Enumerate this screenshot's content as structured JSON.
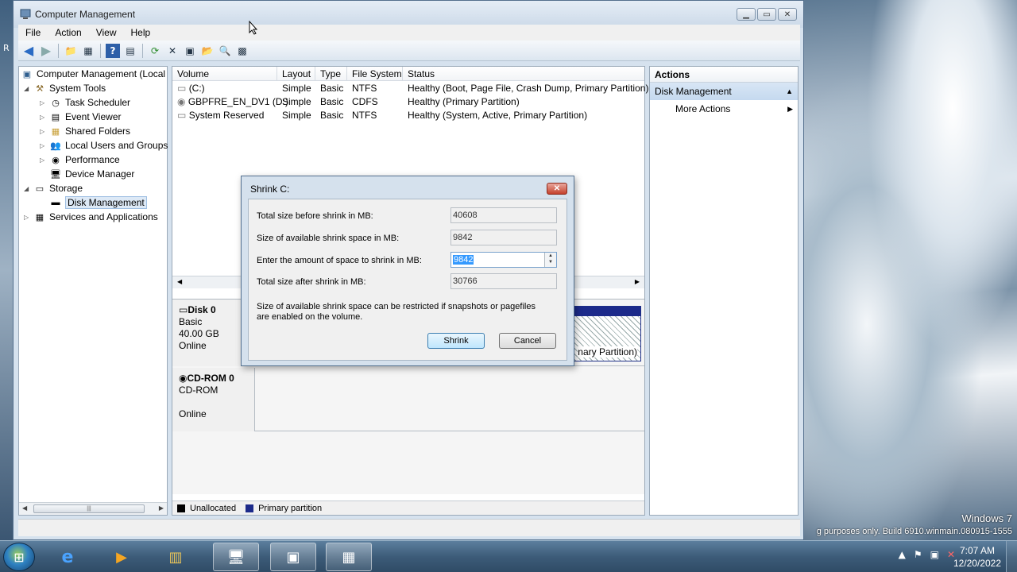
{
  "window": {
    "title": "Computer Management",
    "menu": [
      "File",
      "Action",
      "View",
      "Help"
    ]
  },
  "tree": {
    "root": "Computer Management (Local",
    "system_tools": "System Tools",
    "task_scheduler": "Task Scheduler",
    "event_viewer": "Event Viewer",
    "shared_folders": "Shared Folders",
    "local_users": "Local Users and Groups",
    "performance": "Performance",
    "device_manager": "Device Manager",
    "storage": "Storage",
    "disk_management": "Disk Management",
    "services": "Services and Applications"
  },
  "volumes": {
    "headers": [
      "Volume",
      "Layout",
      "Type",
      "File System",
      "Status"
    ],
    "rows": [
      {
        "volume": "(C:)",
        "layout": "Simple",
        "type": "Basic",
        "fs": "NTFS",
        "status": "Healthy (Boot, Page File, Crash Dump, Primary Partition)"
      },
      {
        "volume": "GBPFRE_EN_DV1 (D:)",
        "layout": "Simple",
        "type": "Basic",
        "fs": "CDFS",
        "status": "Healthy (Primary Partition)"
      },
      {
        "volume": "System Reserved",
        "layout": "Simple",
        "type": "Basic",
        "fs": "NTFS",
        "status": "Healthy (System, Active, Primary Partition)"
      }
    ]
  },
  "disks": {
    "disk0": {
      "name": "Disk 0",
      "type": "Basic",
      "size": "40.00 GB",
      "state": "Online",
      "partition_text": "nary Partition)"
    },
    "cdrom0": {
      "name": "CD-ROM 0",
      "type": "CD-ROM",
      "state": "Online"
    }
  },
  "legend": {
    "unallocated": "Unallocated",
    "primary": "Primary partition"
  },
  "actions": {
    "header": "Actions",
    "section": "Disk Management",
    "more": "More Actions"
  },
  "dialog": {
    "title": "Shrink C:",
    "close": "✕",
    "total_before_label": "Total size before shrink in MB:",
    "total_before_value": "40608",
    "available_label": "Size of available shrink space in MB:",
    "available_value": "9842",
    "amount_label": "Enter the amount of space to shrink in MB:",
    "amount_value": "9842",
    "total_after_label": "Total size after shrink in MB:",
    "total_after_value": "30766",
    "note_line1": "Size of available shrink space can be restricted if snapshots or pagefiles",
    "note_line2": "are enabled on the volume.",
    "shrink_button": "Shrink",
    "cancel_button": "Cancel"
  },
  "desktop": {
    "watermark1": "Windows 7",
    "watermark2": "g purposes only. Build 6910.winmain.080915-1555",
    "left_letter": "R"
  },
  "taskbar": {
    "time": "7:07 AM",
    "date": "12/20/2022"
  },
  "colors": {
    "unallocated": "#000000",
    "primary_partition": "#1c2a8a",
    "selection": "#3399ff"
  }
}
